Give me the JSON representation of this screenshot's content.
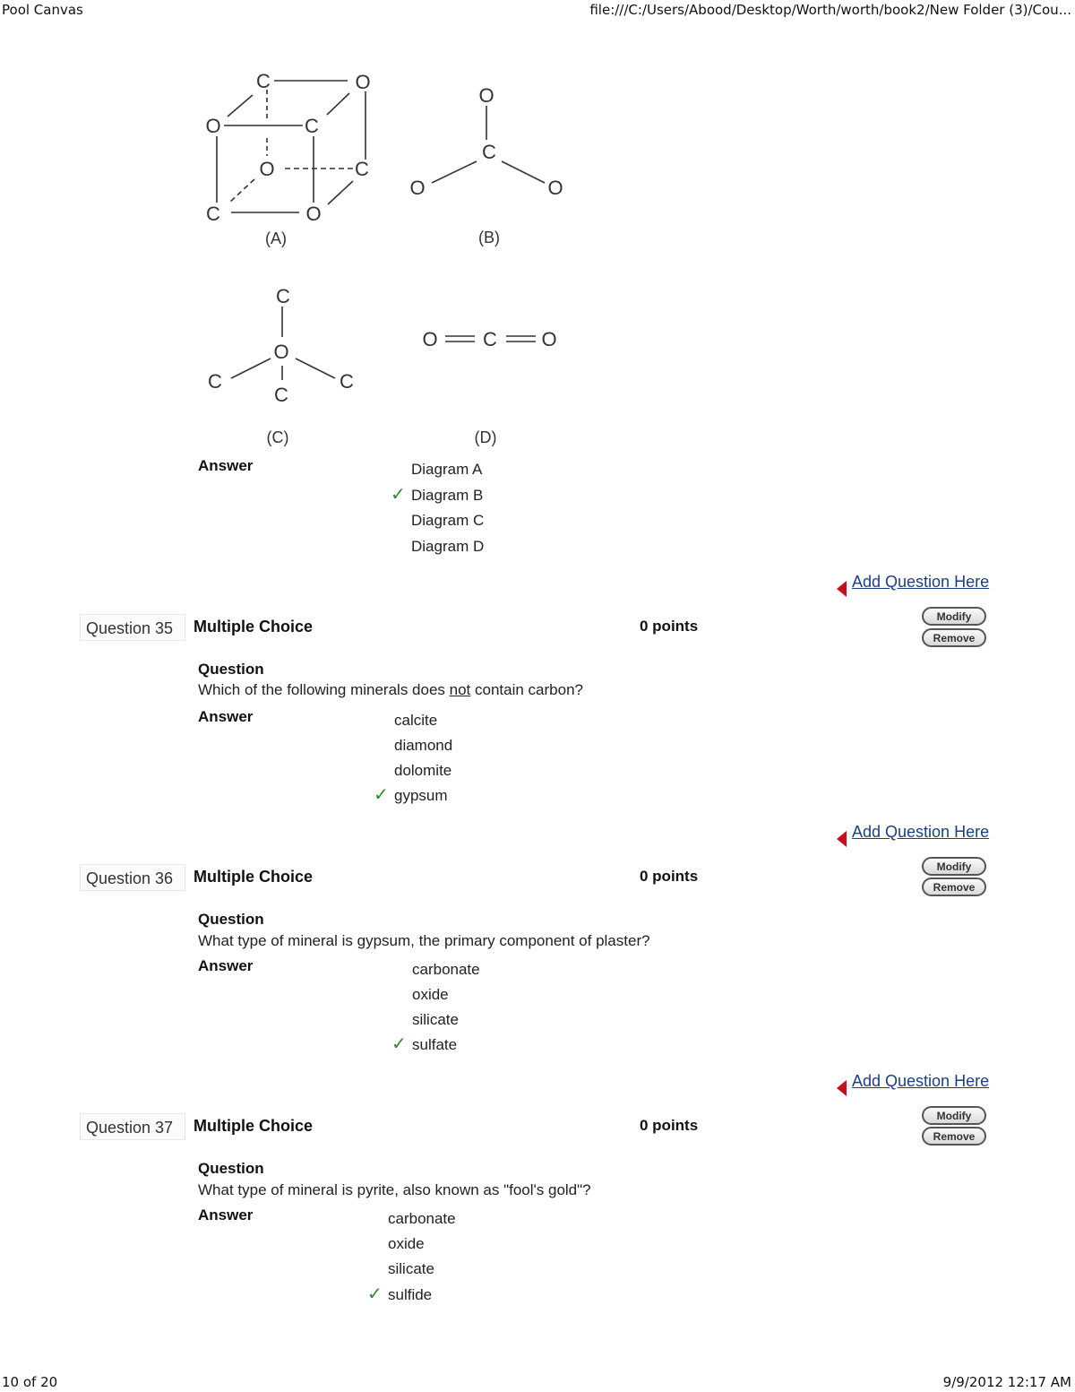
{
  "print_header": {
    "title": "Pool Canvas",
    "url": "file:///C:/Users/Abood/Desktop/Worth/worth/book2/New Folder (3)/Cou..."
  },
  "print_footer": {
    "page": "10 of 20",
    "datetime": "9/9/2012 12:17 AM"
  },
  "diagrams": {
    "A": {
      "caption": "(A)",
      "atoms": [
        "C",
        "O",
        "O",
        "C",
        "O",
        "C",
        "C",
        "O"
      ]
    },
    "B": {
      "caption": "(B)",
      "atoms": [
        "O",
        "C",
        "O",
        "O"
      ]
    },
    "C": {
      "caption": "(C)",
      "atoms": [
        "C",
        "O",
        "C",
        "C",
        "C"
      ]
    },
    "D": {
      "caption": "(D)",
      "atoms": [
        "O",
        "C",
        "O"
      ]
    }
  },
  "q34": {
    "answer_label": "Answer",
    "choices": [
      "Diagram A",
      "Diagram B",
      "Diagram C",
      "Diagram D"
    ],
    "correct_index": 1
  },
  "labels": {
    "add_question": "Add Question Here",
    "modify": "Modify",
    "remove": "Remove",
    "question": "Question",
    "answer": "Answer",
    "check": "✓"
  },
  "questions": [
    {
      "number": "Question 35",
      "type": "Multiple Choice",
      "points": "0 points",
      "text_before": "Which of the following minerals does ",
      "text_underlined": "not",
      "text_after": " contain carbon?",
      "choices": [
        "calcite",
        "diamond",
        "dolomite",
        "gypsum"
      ],
      "correct_index": 3
    },
    {
      "number": "Question 36",
      "type": "Multiple Choice",
      "points": "0 points",
      "text_before": "What type of mineral is gypsum, the primary component of plaster?",
      "text_underlined": "",
      "text_after": "",
      "choices": [
        "carbonate",
        "oxide",
        "silicate",
        "sulfate"
      ],
      "correct_index": 3
    },
    {
      "number": "Question 37",
      "type": "Multiple Choice",
      "points": "0 points",
      "text_before": "What type of mineral is pyrite, also known as \"fool's gold\"?",
      "text_underlined": "",
      "text_after": "",
      "choices": [
        "carbonate",
        "oxide",
        "silicate",
        "sulfide"
      ],
      "correct_index": 3
    }
  ]
}
